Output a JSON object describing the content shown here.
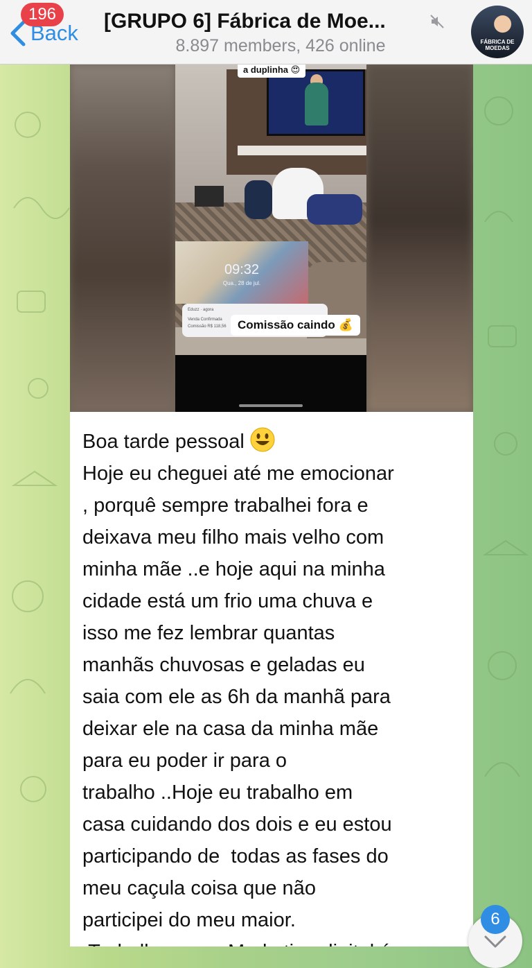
{
  "header": {
    "back_label": "Back",
    "unread_count": "196",
    "title": "[GRUPO 6] Fábrica de Moe...",
    "subtitle": "8.897 members, 426 online",
    "avatar_text": "FÁBRICA DE MOEDAS",
    "muted": true
  },
  "media": {
    "sticker_top": "a duplinha 😍",
    "clock_time": "09:32",
    "clock_date": "Qua., 28 de jul.",
    "notification": {
      "app": "Eduzz · agora",
      "line1": "Venda Confirmada",
      "line2": "Comissão R$ 118,56"
    },
    "sticker_commission": "Comissão caindo 💰"
  },
  "message": {
    "greeting": "Boa tarde pessoal ",
    "body": "Hoje eu cheguei até me emocionar\n, porquê sempre trabalhei fora e\ndeixava meu filho mais velho com\nminha mãe ..e hoje aqui na minha\ncidade está um frio uma chuva e\nisso me fez lembrar quantas\nmanhãs chuvosas e geladas eu\nsaia com ele as 6h da manhã para\ndeixar ele na casa da minha mãe\npara eu poder ir para o\ntrabalho ..Hoje eu trabalho em\ncasa cuidando dos dois e eu estou\nparticipando de  todas as fases do\nmeu caçula coisa que não\nparticipei do meu maior.\n Trabalhar com  Marketing digital é"
  },
  "scroll_button": {
    "unread_count": "6"
  },
  "colors": {
    "accent": "#2f8de4",
    "badge_red": "#e8414a",
    "wallpaper_green": "#a8d08a"
  }
}
